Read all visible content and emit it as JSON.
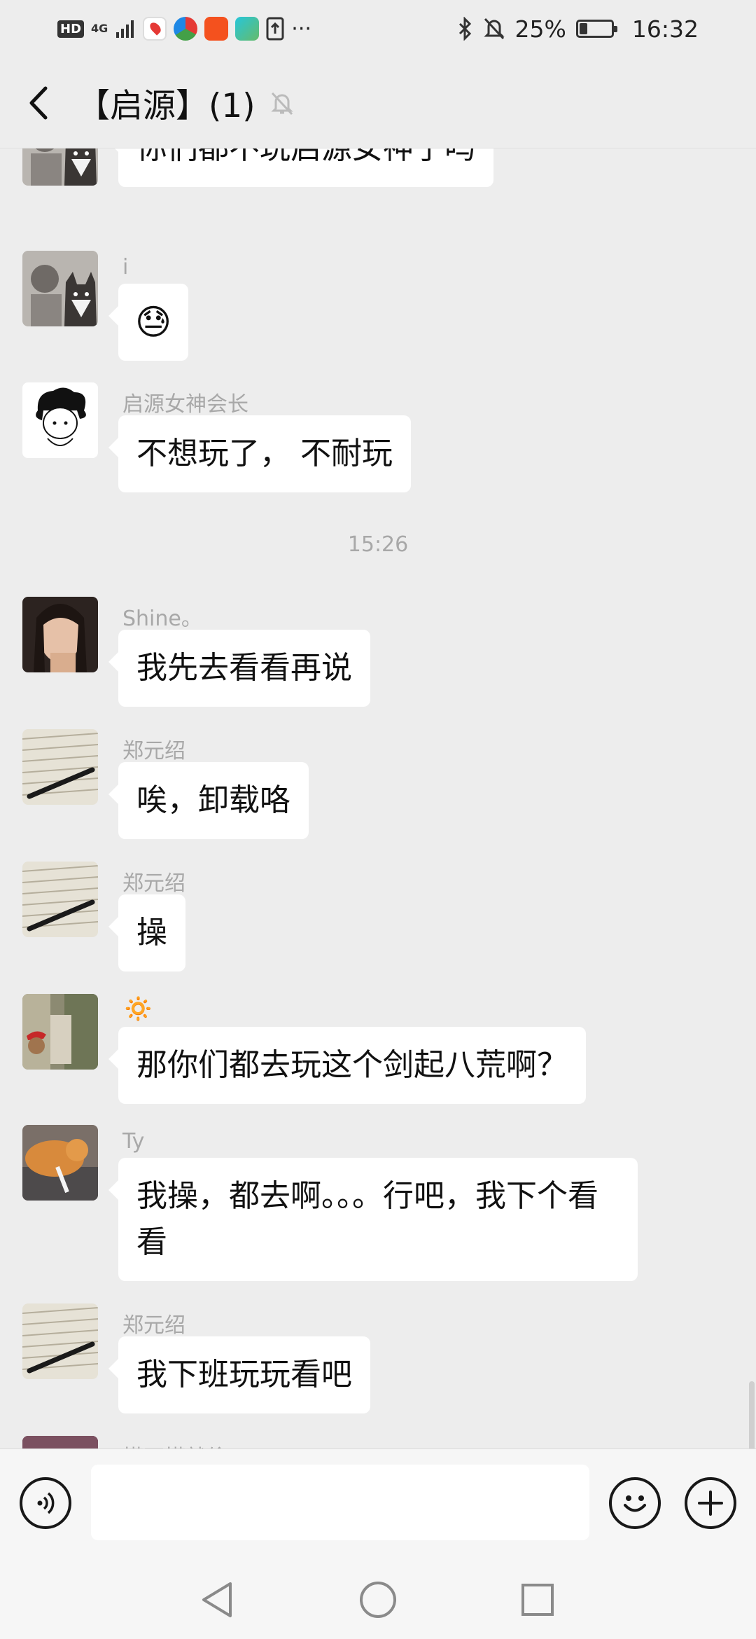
{
  "status_bar": {
    "hd": "HD",
    "network": "4G",
    "more": "···",
    "battery": "25%",
    "battery_level": 0.25,
    "time": "16:32"
  },
  "header": {
    "title": "【启源】(1)"
  },
  "messages": [
    {
      "sender": "",
      "text": "你们都不玩启源女神了吗",
      "avatar": "husky-photo"
    },
    {
      "sender": "i",
      "text": "😓",
      "avatar": "husky-photo"
    },
    {
      "sender": "启源女神会长",
      "text": "不想玩了， 不耐玩",
      "avatar": "cartoon-boy"
    },
    {
      "sender": "Shine。",
      "text": "我先去看看再说",
      "avatar": "girl-photo"
    },
    {
      "sender": "郑元绍",
      "text": "唉，卸载咯",
      "avatar": "book-photo"
    },
    {
      "sender": "郑元绍",
      "text": "操",
      "avatar": "book-photo"
    },
    {
      "sender": "🔅",
      "text": "那你们都去玩这个剑起八荒啊？",
      "avatar": "dog-santa-photo"
    },
    {
      "sender": "Ty",
      "text": "我操，都去啊。。。行吧，我下个看看",
      "avatar": "cat-photo"
    },
    {
      "sender": "郑元绍",
      "text": "我下班玩玩看吧",
      "avatar": "book-photo"
    },
    {
      "sender": "懂不懂就偷",
      "text": "",
      "avatar": "partial-photo"
    }
  ],
  "time_separator": "15:26",
  "input": {
    "placeholder": ""
  },
  "colors": {
    "background": "#ededed",
    "bubble": "#ffffff",
    "sender": "#a8a8a8"
  }
}
